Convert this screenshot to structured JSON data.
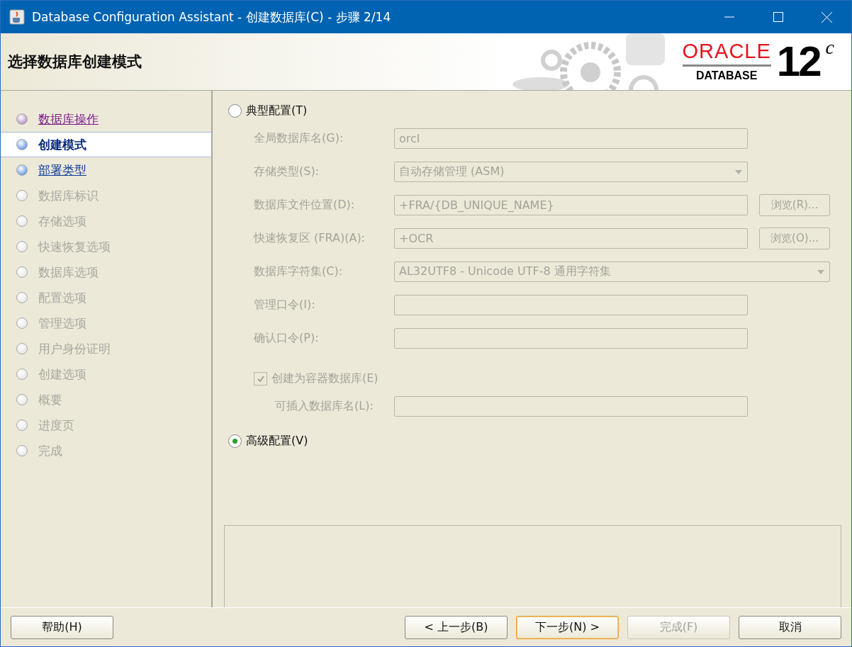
{
  "window": {
    "title": "Database Configuration Assistant - 创建数据库(C) - 步骤 2/14"
  },
  "header": {
    "title": "选择数据库创建模式",
    "logo": {
      "brand": "ORACLE",
      "product": "DATABASE",
      "version": "12",
      "suffix": "c"
    }
  },
  "steps": [
    {
      "label": "数据库操作",
      "kind": "visited",
      "selected": false
    },
    {
      "label": "创建模式",
      "kind": "current",
      "selected": true
    },
    {
      "label": "部署类型",
      "kind": "available",
      "selected": false
    },
    {
      "label": "数据库标识",
      "kind": "pending",
      "selected": false
    },
    {
      "label": "存储选项",
      "kind": "pending",
      "selected": false
    },
    {
      "label": "快速恢复选项",
      "kind": "pending",
      "selected": false
    },
    {
      "label": "数据库选项",
      "kind": "pending",
      "selected": false
    },
    {
      "label": "配置选项",
      "kind": "pending",
      "selected": false
    },
    {
      "label": "管理选项",
      "kind": "pending",
      "selected": false
    },
    {
      "label": "用户身份证明",
      "kind": "pending",
      "selected": false
    },
    {
      "label": "创建选项",
      "kind": "pending",
      "selected": false
    },
    {
      "label": "概要",
      "kind": "pending",
      "selected": false
    },
    {
      "label": "进度页",
      "kind": "pending",
      "selected": false
    },
    {
      "label": "完成",
      "kind": "pending",
      "selected": false
    }
  ],
  "typical": {
    "label": "典型配置(T)",
    "selected": false,
    "disabled": true,
    "fields": [
      {
        "kind": "text",
        "label": "全局数据库名(G):",
        "value": "orcl"
      },
      {
        "kind": "select",
        "label": "存储类型(S):",
        "value": "自动存储管理 (ASM)"
      },
      {
        "kind": "browse",
        "label": "数据库文件位置(D):",
        "value": "+FRA/{DB_UNIQUE_NAME}",
        "button": "浏览(R)..."
      },
      {
        "kind": "browse",
        "label": "快速恢复区 (FRA)(A):",
        "value": "+OCR",
        "button": "浏览(O)..."
      },
      {
        "kind": "wideselect",
        "label": "数据库字符集(C):",
        "value": "AL32UTF8 - Unicode UTF-8 通用字符集"
      },
      {
        "kind": "text",
        "label": "管理口令(I):"
      },
      {
        "kind": "text",
        "label": "确认口令(P):"
      }
    ],
    "container": {
      "label": "创建为容器数据库(E)",
      "checked": true
    },
    "pluggable": {
      "label": "可插入数据库名(L):"
    }
  },
  "advanced": {
    "label": "高级配置(V)",
    "selected": true
  },
  "buttons": [
    {
      "label": "帮助(H)",
      "disabled": false,
      "default": false
    },
    {
      "label": "< 上一步(B)",
      "disabled": false,
      "default": false
    },
    {
      "label": "下一步(N) >",
      "disabled": false,
      "default": true
    },
    {
      "label": "完成(F)",
      "disabled": true,
      "default": false
    },
    {
      "label": "取消",
      "disabled": false,
      "default": false
    }
  ]
}
